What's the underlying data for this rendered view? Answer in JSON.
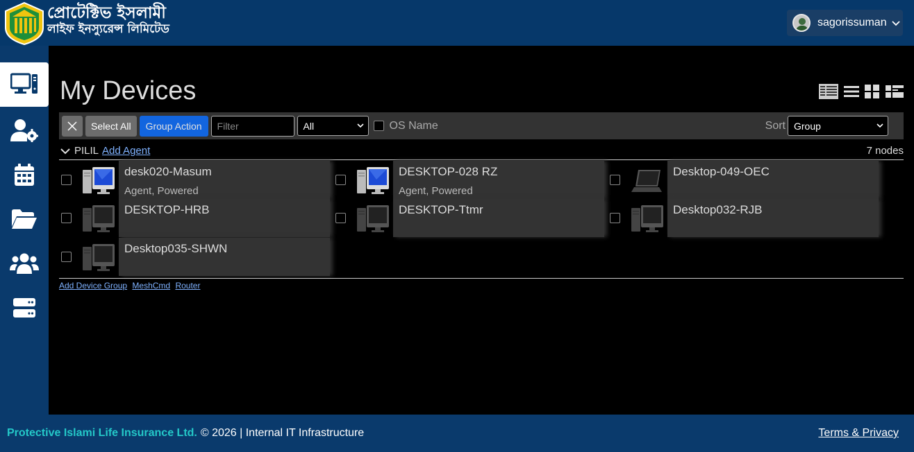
{
  "header": {
    "brand_line1": "প্রোটেক্টিভ ইসলামী",
    "brand_line2": "লাইফ ইনস্যুরেন্স লিমিটেড",
    "username": "sagorissuman"
  },
  "sidebar": {
    "items": [
      {
        "icon": "computer-icon",
        "active": true
      },
      {
        "icon": "user-gear-icon",
        "active": false
      },
      {
        "icon": "calendar-icon",
        "active": false
      },
      {
        "icon": "folder-open-icon",
        "active": false
      },
      {
        "icon": "users-icon",
        "active": false
      },
      {
        "icon": "server-icon",
        "active": false
      }
    ]
  },
  "main": {
    "title": "My Devices",
    "toolbar": {
      "select_all": "Select All",
      "group_action": "Group Action",
      "filter_placeholder": "Filter",
      "filter_type": "All",
      "os_name": "OS Name",
      "sort_label": "Sort",
      "sort_value": "Group"
    },
    "group": {
      "name": "PILIL",
      "add_agent": "Add Agent",
      "node_count": "7 nodes"
    },
    "devices": [
      {
        "name": "desk020-Masum",
        "status": "Agent, Powered",
        "online": true,
        "icon": "desktop-icon"
      },
      {
        "name": "DESKTOP-028 RZ",
        "status": "Agent, Powered",
        "online": true,
        "icon": "desktop-icon"
      },
      {
        "name": "Desktop-049-OEC",
        "status": "",
        "online": false,
        "icon": "laptop-icon"
      },
      {
        "name": "DESKTOP-HRB",
        "status": "",
        "online": false,
        "icon": "desktop-icon"
      },
      {
        "name": "DESKTOP-Ttmr",
        "status": "",
        "online": false,
        "icon": "desktop-icon"
      },
      {
        "name": "Desktop032-RJB",
        "status": "",
        "online": false,
        "icon": "desktop-icon"
      },
      {
        "name": "Desktop035-SHWN",
        "status": "",
        "online": false,
        "icon": "desktop-icon"
      }
    ],
    "bottom_links": {
      "add_device_group": "Add Device Group",
      "meshcmd": "MeshCmd",
      "router": "Router"
    }
  },
  "footer": {
    "company": "Protective Islami Life Insurance Ltd.",
    "copyright": "© 2026 | Internal IT Infrastructure",
    "terms": "Terms & Privacy"
  },
  "colors": {
    "header_bg": "#06386a",
    "accent_blue": "#0d6efd",
    "company_teal": "#24c8c8"
  }
}
